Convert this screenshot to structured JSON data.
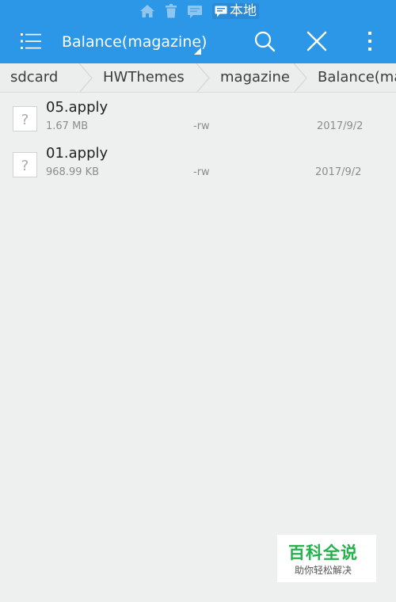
{
  "status_bar": {
    "icons": [
      "home-icon",
      "trash-icon",
      "message-icon",
      "chat-bubble-icon"
    ],
    "label": "本地",
    "color": "#2c97e6"
  },
  "toolbar": {
    "title": "Balance(magazine)",
    "menu_icon": "menu-list-icon",
    "search_icon": "search-icon",
    "close_icon": "close-icon",
    "more_icon": "more-vertical-icon",
    "color": "#2c97e6"
  },
  "breadcrumb": {
    "items": [
      "sdcard",
      "HWThemes",
      "magazine",
      "Balance(ma"
    ]
  },
  "files": [
    {
      "name": "05.apply",
      "size": "1.67 MB",
      "permissions": "-rw",
      "date": "2017/9/2",
      "icon": "unknown-file-icon"
    },
    {
      "name": "01.apply",
      "size": "968.99 KB",
      "permissions": "-rw",
      "date": "2017/9/2",
      "icon": "unknown-file-icon"
    }
  ],
  "watermark": {
    "title": "百科全说",
    "subtitle": "助你轻松解决",
    "color": "#23b24b"
  }
}
